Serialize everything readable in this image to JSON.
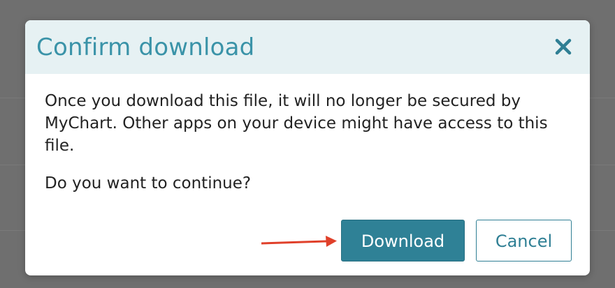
{
  "dialog": {
    "title": "Confirm download",
    "close_icon": "close-icon",
    "message": "Once you download this file, it will no longer be secured by MyChart. Other apps on your device might have access to this file.",
    "question": "Do you want to continue?",
    "download_label": "Download",
    "cancel_label": "Cancel"
  },
  "annotation": {
    "arrow_icon": "arrow-right-icon",
    "arrow_color": "#e0402a"
  },
  "colors": {
    "accent": "#2f8196",
    "title": "#3a93a8",
    "header_bg": "#e6f1f3",
    "backdrop": "#6f6f6f"
  }
}
